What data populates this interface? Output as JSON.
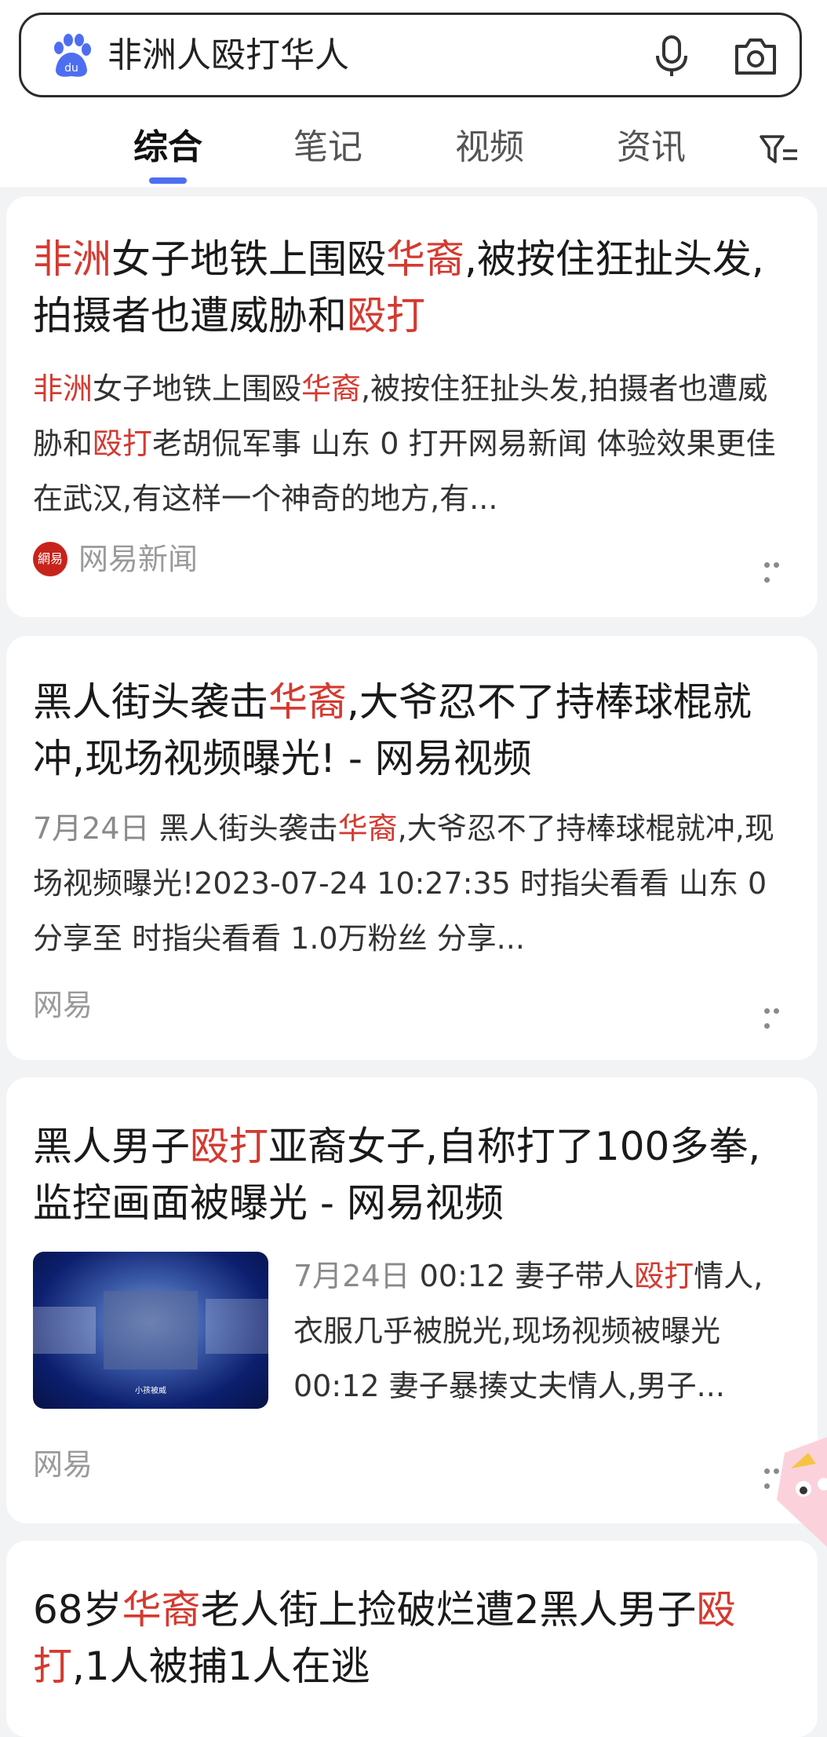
{
  "search": {
    "query": "非洲人殴打华人"
  },
  "tabs": [
    "综合",
    "笔记",
    "视频",
    "资讯"
  ],
  "results": [
    {
      "title": [
        [
          "非洲",
          true
        ],
        [
          "女子地铁上围殴",
          false
        ],
        [
          "华裔",
          true
        ],
        [
          ",被按住狂扯头发,拍摄者也遭威胁和",
          false
        ],
        [
          "殴打",
          true
        ]
      ],
      "snippet": [
        [
          "非洲",
          true
        ],
        [
          "女子地铁上围殴",
          false
        ],
        [
          "华裔",
          true
        ],
        [
          ",被按住狂扯头发,拍摄者也遭威胁和",
          false
        ],
        [
          "殴打",
          true
        ],
        [
          "老胡侃军事 山东 0 打开网易新闻 体验效果更佳在武汉,有这样一个神奇的地方,有...",
          false
        ]
      ],
      "source": "网易新闻",
      "logo_text": "網易"
    },
    {
      "title": [
        [
          "黑人街头袭击",
          false
        ],
        [
          "华裔",
          true
        ],
        [
          ",大爷忍不了持棒球棍就冲,现场视频曝光! - 网易视频",
          false
        ]
      ],
      "date": "7月24日",
      "snippet": [
        [
          "黑人街头袭击",
          false
        ],
        [
          "华裔",
          true
        ],
        [
          ",大爷忍不了持棒球棍就冲,现场视频曝光!2023-07-24 10:27:35 时指尖看看 山东 0 分享至 时指尖看看 1.0万粉丝 分享...",
          false
        ]
      ],
      "source": "网易"
    },
    {
      "title": [
        [
          "黑人男子",
          false
        ],
        [
          "殴打",
          true
        ],
        [
          "亚裔女子,自称打了100多拳,监控画面被曝光 - 网易视频",
          false
        ]
      ],
      "date": "7月24日",
      "snippet": [
        [
          "00:12 妻子带人",
          false
        ],
        [
          "殴打",
          true
        ],
        [
          "情人,衣服几乎被脱光,现场视频被曝光 00:12 妻子暴揍丈夫情人,男子...",
          false
        ]
      ],
      "source": "网易",
      "thumb_caption": "小孩被威"
    },
    {
      "title": [
        [
          "68岁",
          false
        ],
        [
          "华裔",
          true
        ],
        [
          "老人街上捡破烂遭2黑人男子",
          false
        ],
        [
          "殴打",
          true
        ],
        [
          ",1人被捕1人在逃",
          false
        ]
      ]
    }
  ],
  "colors": {
    "highlight": "#d43a30",
    "accent": "#4e6ef2",
    "logo": "#4e6ef2"
  },
  "icons": [
    "baidu-logo-icon",
    "microphone-icon",
    "camera-icon",
    "filter-icon",
    "more-icon"
  ]
}
